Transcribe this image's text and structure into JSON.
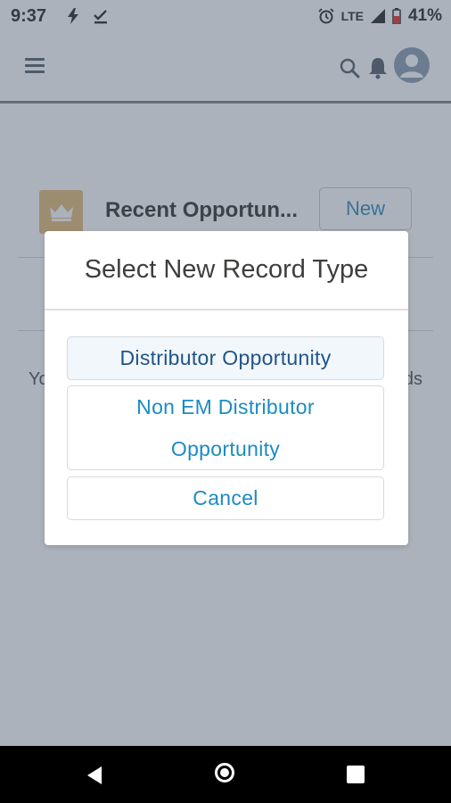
{
  "status_bar": {
    "time": "9:37",
    "network": "LTE",
    "battery": "41%"
  },
  "app_bar": {
    "icons": [
      "menu-icon",
      "search-icon",
      "bell-icon",
      "avatar"
    ]
  },
  "list_card": {
    "title": "Recent Opportun...",
    "new_button": "New",
    "empty_message_left": "Yo",
    "empty_message_right": "ds",
    "icon": "crown-icon",
    "icon_color": "#e3c07f"
  },
  "modal": {
    "title": "Select New Record Type",
    "options": [
      {
        "label": "Distributor Opportunity",
        "selected": true
      },
      {
        "label_line1": "Non EM Distributor",
        "label_line2": "Opportunity",
        "selected": false
      }
    ],
    "cancel_label": "Cancel"
  },
  "colors": {
    "accent": "#1b8bc3",
    "selected_text": "#205487",
    "overlay": "rgba(58,72,92,0.42)"
  },
  "nav_bar": {
    "icons": [
      "back-icon",
      "home-icon",
      "recents-icon"
    ]
  }
}
